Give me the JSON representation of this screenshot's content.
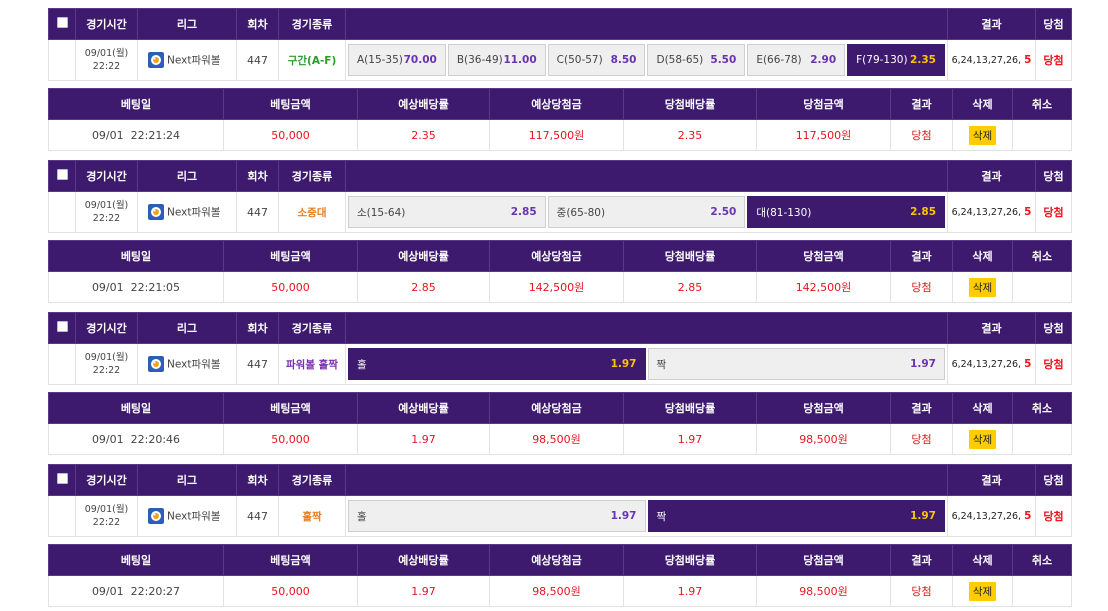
{
  "headers": {
    "check": "",
    "time": "경기시간",
    "league": "리그",
    "round": "회차",
    "type": "경기종류",
    "result": "결과",
    "win": "당첨"
  },
  "bet_headers": [
    "베팅일",
    "베팅금액",
    "예상배당률",
    "예상당첨금",
    "당첨배당률",
    "당첨금액",
    "결과",
    "삭제",
    "취소"
  ],
  "colors": {
    "header_bg": "#3d1a6e",
    "selected_odds": "#ffc300",
    "odds": "#6a32b0",
    "win_red": "#e8141e",
    "delete_btn": "#ffcc00"
  },
  "bets": [
    {
      "time_date": "09/01(월)",
      "time_clock": "22:22",
      "league": "Next파워볼",
      "round": "447",
      "game_type": "구간(A-F)",
      "game_type_color": "green",
      "options": [
        {
          "label": "A(15-35)",
          "odds": "70.00",
          "selected": false
        },
        {
          "label": "B(36-49)",
          "odds": "11.00",
          "selected": false
        },
        {
          "label": "C(50-57)",
          "odds": "8.50",
          "selected": false
        },
        {
          "label": "D(58-65)",
          "odds": "5.50",
          "selected": false
        },
        {
          "label": "E(66-78)",
          "odds": "2.90",
          "selected": false
        },
        {
          "label": "F(79-130)",
          "odds": "2.35",
          "selected": true
        }
      ],
      "result_numbers": "6,24,13,27,26,",
      "result_highlight": "5",
      "win_status": "당첨",
      "bet_date": "09/01  22:21:24",
      "bet_amount": "50,000",
      "expected_odds": "2.35",
      "expected_payout": "117,500원",
      "win_odds": "2.35",
      "win_amount": "117,500원",
      "bet_result": "당첨",
      "delete_label": "삭제",
      "cancel_label": ""
    },
    {
      "time_date": "09/01(월)",
      "time_clock": "22:22",
      "league": "Next파워볼",
      "round": "447",
      "game_type": "소중대",
      "game_type_color": "orange",
      "options": [
        {
          "label": "소(15-64)",
          "odds": "2.85",
          "selected": false
        },
        {
          "label": "중(65-80)",
          "odds": "2.50",
          "selected": false
        },
        {
          "label": "대(81-130)",
          "odds": "2.85",
          "selected": true
        }
      ],
      "result_numbers": "6,24,13,27,26,",
      "result_highlight": "5",
      "win_status": "당첨",
      "bet_date": "09/01  22:21:05",
      "bet_amount": "50,000",
      "expected_odds": "2.85",
      "expected_payout": "142,500원",
      "win_odds": "2.85",
      "win_amount": "142,500원",
      "bet_result": "당첨",
      "delete_label": "삭제",
      "cancel_label": ""
    },
    {
      "time_date": "09/01(월)",
      "time_clock": "22:22",
      "league": "Next파워볼",
      "round": "447",
      "game_type": "파워볼 홀짝",
      "game_type_color": "purple",
      "options": [
        {
          "label": "홀",
          "odds": "1.97",
          "selected": true
        },
        {
          "label": "짝",
          "odds": "1.97",
          "selected": false
        }
      ],
      "result_numbers": "6,24,13,27,26,",
      "result_highlight": "5",
      "win_status": "당첨",
      "bet_date": "09/01  22:20:46",
      "bet_amount": "50,000",
      "expected_odds": "1.97",
      "expected_payout": "98,500원",
      "win_odds": "1.97",
      "win_amount": "98,500원",
      "bet_result": "당첨",
      "delete_label": "삭제",
      "cancel_label": ""
    },
    {
      "time_date": "09/01(월)",
      "time_clock": "22:22",
      "league": "Next파워볼",
      "round": "447",
      "game_type": "홀짝",
      "game_type_color": "orange",
      "options": [
        {
          "label": "홀",
          "odds": "1.97",
          "selected": false
        },
        {
          "label": "짝",
          "odds": "1.97",
          "selected": true
        }
      ],
      "result_numbers": "6,24,13,27,26,",
      "result_highlight": "5",
      "win_status": "당첨",
      "bet_date": "09/01  22:20:27",
      "bet_amount": "50,000",
      "expected_odds": "1.97",
      "expected_payout": "98,500원",
      "win_odds": "1.97",
      "win_amount": "98,500원",
      "bet_result": "당첨",
      "delete_label": "삭제",
      "cancel_label": ""
    }
  ]
}
